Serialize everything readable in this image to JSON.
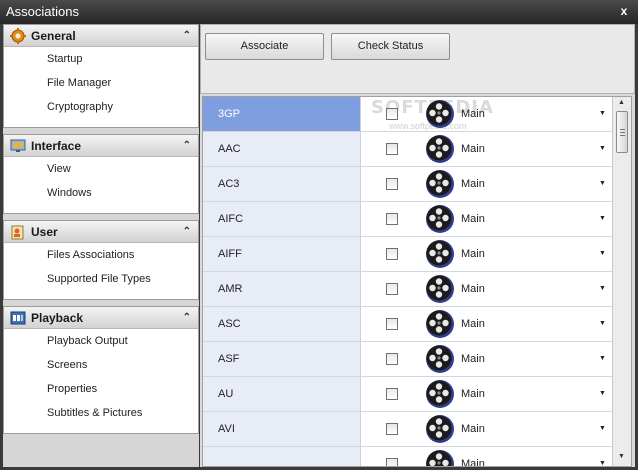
{
  "window": {
    "title": "Associations",
    "close_label": "x"
  },
  "sidebar": {
    "groups": [
      {
        "label": "General",
        "collapse": "⌃",
        "icon": "gear-icon",
        "items": [
          "Startup",
          "File Manager",
          "Cryptography"
        ]
      },
      {
        "label": "Interface",
        "collapse": "⌃",
        "icon": "monitor-icon",
        "items": [
          "View",
          "Windows"
        ]
      },
      {
        "label": "User",
        "collapse": "⌃",
        "icon": "user-icon",
        "items": [
          "Files Associations",
          "Supported File Types"
        ]
      },
      {
        "label": "Playback",
        "collapse": "⌃",
        "icon": "playback-icon",
        "items": [
          "Playback Output",
          "Screens",
          "Properties",
          "Subtitles & Pictures"
        ]
      }
    ]
  },
  "toolbar": {
    "associate_label": "Associate",
    "check_status_label": "Check Status"
  },
  "grid": {
    "option_value": "Main",
    "dropdown_glyph": "▼",
    "rows": [
      "3GP",
      "AAC",
      "AC3",
      "AIFC",
      "AIFF",
      "AMR",
      "ASC",
      "ASF",
      "AU",
      "AVI",
      ""
    ],
    "selected_row": "3GP"
  },
  "watermark": {
    "text": "SOFTPEDIA",
    "subtext": "www.softpedia.com"
  },
  "colors": {
    "selected_row": "#7f9ee0",
    "name_cell": "#e8ecf6",
    "title_bar": "#262626"
  }
}
